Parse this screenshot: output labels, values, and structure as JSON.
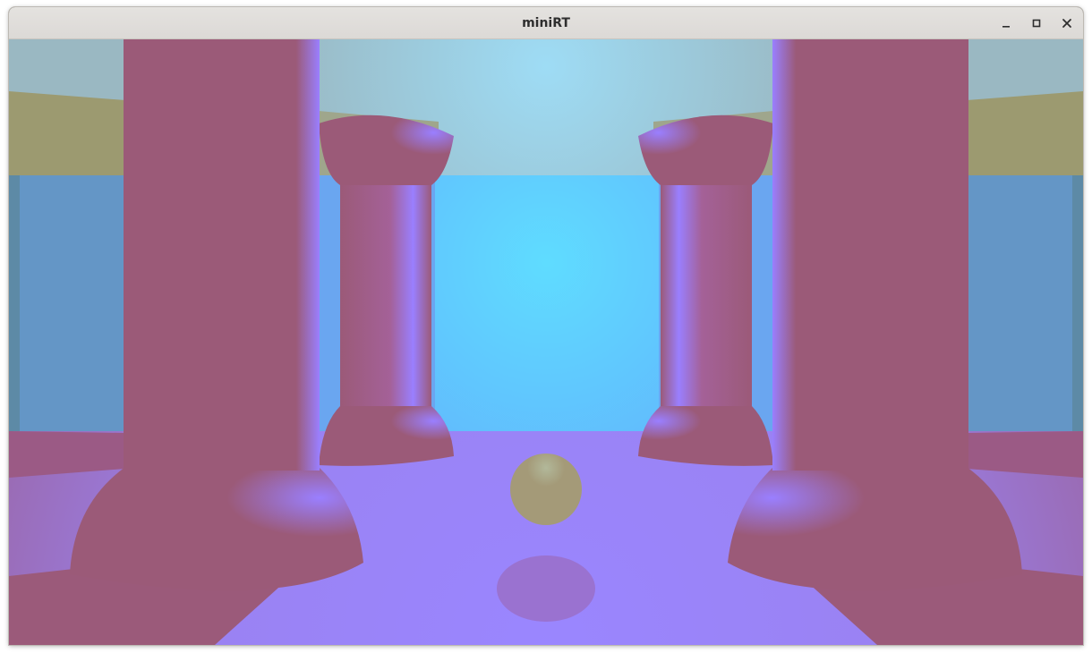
{
  "window": {
    "title": "miniRT",
    "controls": [
      {
        "name": "minimize",
        "icon": "minimize-icon"
      },
      {
        "name": "maximize",
        "icon": "maximize-icon"
      },
      {
        "name": "close",
        "icon": "close-icon"
      }
    ]
  },
  "scene": {
    "colors": {
      "column": "#9b5a78",
      "column_highlight": "#9a7fff",
      "floor": "#9a82f2",
      "floor_edge": "#9a6ab0",
      "back_wall": "#62aefc",
      "back_light": "#5fdcff",
      "ceiling": "#9ab8c2",
      "ceiling_light": "#9edcf5",
      "side_band": "#9c9a70",
      "side_wall": "#6496c6",
      "sphere": "#a49a78",
      "sphere_shadow": "#9a6fc8"
    },
    "objects": [
      {
        "name": "large-left-column",
        "type": "cylinder-with-hemisphere-base"
      },
      {
        "name": "large-right-column",
        "type": "cylinder-with-hemisphere-base"
      },
      {
        "name": "small-left-column",
        "type": "cylinder-with-caps"
      },
      {
        "name": "small-right-column",
        "type": "cylinder-with-caps"
      },
      {
        "name": "center-sphere",
        "type": "sphere"
      }
    ]
  }
}
